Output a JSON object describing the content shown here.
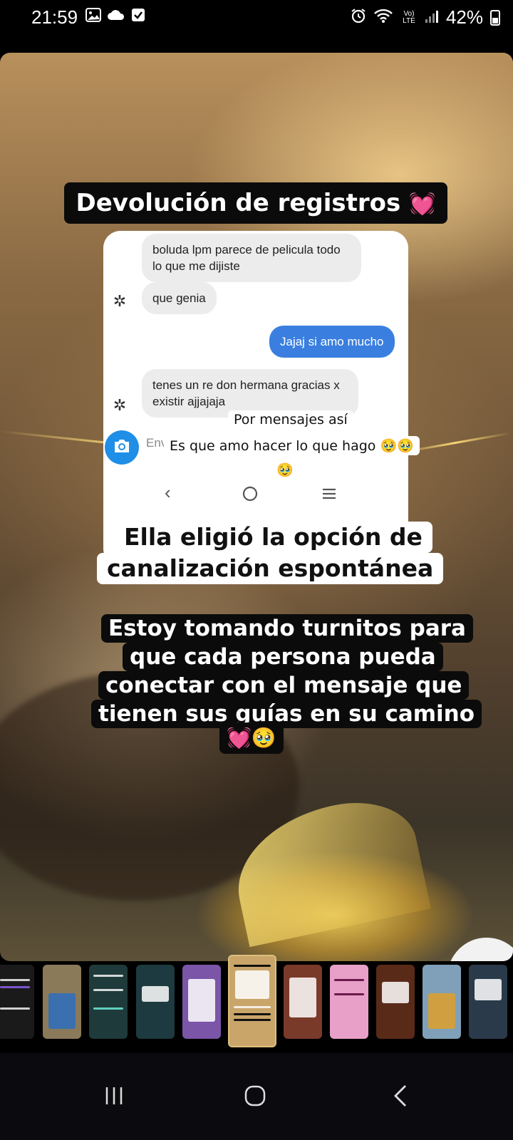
{
  "status_bar": {
    "time": "21:59",
    "battery": "42%",
    "left_icons": [
      "image-icon",
      "cloud-icon",
      "checkbox-icon"
    ],
    "right_icons": [
      "alarm-icon",
      "wifi-icon",
      "volte-icon",
      "signal-icon",
      "battery-icon"
    ],
    "volte_text": "Vo) LTE"
  },
  "story": {
    "heading": "Devolución de registros",
    "heading_emoji": "💓🧚",
    "chat": {
      "messages": [
        {
          "direction": "in",
          "text": "boluda lpm parece de pelicula todo lo que me dijiste"
        },
        {
          "direction": "in",
          "text": "que genia"
        },
        {
          "direction": "out",
          "text": "Jajaj si amo mucho"
        },
        {
          "direction": "in",
          "text": "tenes un re don hermana gracias x existir ajjajaja"
        }
      ],
      "compose_placeholder": "Env",
      "avatar_glyph": "✲"
    },
    "caption_1": "Por mensajes así",
    "caption_2": "Es que amo hacer lo que hago",
    "caption_2_emoji": "🥹🥹",
    "caption_2_emoji_b": "🥹",
    "subtitle_line_1": "Ella eligió la opción de",
    "subtitle_line_2": "canalización espontánea",
    "body_lines": [
      "Estoy tomando turnitos para",
      "que cada persona pueda",
      "conectar con el mensaje que",
      "tienen sus guías en su camino"
    ],
    "body_emoji": "💓🥹"
  },
  "thumbnails": {
    "count": 11,
    "selected_index": 5,
    "colors": [
      "#1a1a1a",
      "#8a7a5a",
      "#1f3a3a",
      "#1d3a40",
      "#7a55a8",
      "#c9a56a",
      "#7a3a2a",
      "#e8a0c8",
      "#5a2a18",
      "#7fa0b8",
      "#2a3a4a"
    ]
  },
  "system_nav": {
    "recents": "recents-icon",
    "home": "home-icon",
    "back": "back-icon"
  }
}
